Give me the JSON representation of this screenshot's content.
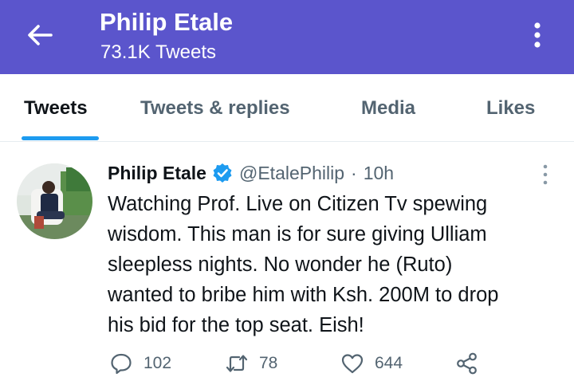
{
  "header": {
    "title": "Philip Etale",
    "subtitle": "73.1K Tweets",
    "icons": {
      "back": "back-arrow-icon",
      "more": "more-vertical-icon"
    },
    "bg_color": "#5b55cc"
  },
  "tabs": [
    {
      "label": "Tweets",
      "active": true
    },
    {
      "label": "Tweets & replies",
      "active": false
    },
    {
      "label": "Media",
      "active": false
    },
    {
      "label": "Likes",
      "active": false
    }
  ],
  "accent_color": "#1d9bf0",
  "tweet": {
    "author_name": "Philip Etale",
    "verified": true,
    "handle": "@EtalePhilip",
    "separator": "·",
    "time": "10h",
    "text_lines": [
      "Watching Prof. Live on Citizen Tv spewing",
      "wisdom. This man is for sure giving Ulliam",
      "sleepless nights. No wonder he (Ruto)",
      "wanted to bribe him with Ksh. 200M to drop",
      "his bid for the top seat. Eish!"
    ],
    "actions": {
      "replies": "102",
      "retweets": "78",
      "likes": "644"
    }
  }
}
